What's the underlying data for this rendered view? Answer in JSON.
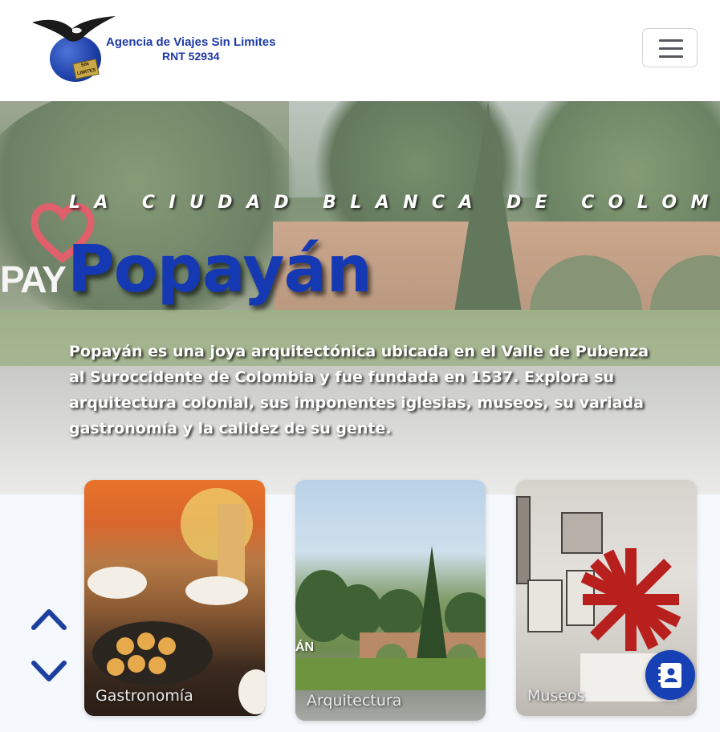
{
  "header": {
    "logo_name": "Agencia de Viajes Sin Limites",
    "logo_rnt": "RNT 52934",
    "logo_tag": "SIN LIMITES",
    "menu_icon": "hamburger-menu-icon"
  },
  "hero": {
    "kicker": "LA CIUDAD BLANCA DE COLOMBIA",
    "title": "Popayán",
    "description": "Popayán es una joya arquitectónica ubicada en el Valle de Pubenza al Suroccidente de Colombia y fue fundada en 1537. Explora su arquitectura colonial, sus imponentes iglesias, museos, su variada gastronomía y la calidez de su gente.",
    "background_sign": "PAY",
    "colors": {
      "title": "#1538b3",
      "text": "#ffffff"
    }
  },
  "cards": {
    "gastronomia": {
      "label": "Gastronomía"
    },
    "arquitectura": {
      "label": "Arquitectura",
      "sign": "ÁN"
    },
    "museos": {
      "label": "Museos"
    }
  },
  "controls": {
    "up_icon": "chevron-up-icon",
    "down_icon": "chevron-down-icon",
    "contact_icon": "contact-book-icon",
    "accent": "#1840b5"
  }
}
